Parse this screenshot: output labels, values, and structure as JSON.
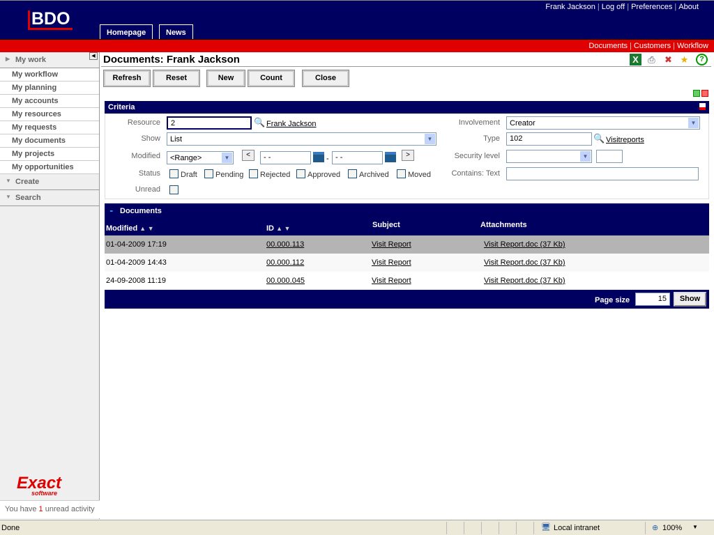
{
  "header": {
    "logo": "BDO",
    "tabs": [
      "Homepage",
      "News"
    ],
    "user_links": [
      "Frank Jackson",
      "Log off",
      "Preferences",
      "About"
    ]
  },
  "redbar": {
    "links": [
      "Documents",
      "Customers",
      "Workflow"
    ]
  },
  "sidebar": {
    "my_work": "My work",
    "items": [
      "My workflow",
      "My planning",
      "My accounts",
      "My resources",
      "My requests",
      "My documents",
      "My projects",
      "My opportunities"
    ],
    "create": "Create",
    "search": "Search",
    "brand": "Exact",
    "brand_sub": "software",
    "unread_prefix": "You have ",
    "unread_count": "1",
    "unread_suffix": " unread activity"
  },
  "page": {
    "title": "Documents: Frank Jackson",
    "toolbar": [
      "Refresh",
      "Reset",
      "New",
      "Count",
      "Close"
    ],
    "icons": [
      "excel-icon",
      "print-icon",
      "tools-icon",
      "favorite-icon",
      "help-icon"
    ]
  },
  "criteria": {
    "title": "Criteria",
    "resource_label": "Resource",
    "resource_value": "2",
    "resource_name": "Frank Jackson",
    "show_label": "Show",
    "show_value": "List",
    "modified_label": "Modified",
    "modified_value": "<Range>",
    "date_from": "- -",
    "date_to": "- -",
    "date_sep": "-",
    "prev": "<",
    "next": ">",
    "status_label": "Status",
    "statuses": [
      "Draft",
      "Pending",
      "Rejected",
      "Approved",
      "Archived",
      "Moved"
    ],
    "unread_label": "Unread",
    "involvement_label": "Involvement",
    "involvement_value": "Creator",
    "type_label": "Type",
    "type_value": "102",
    "type_name": "Visitreports",
    "security_label": "Security level",
    "security_value": "",
    "contains_label": "Contains: Text",
    "contains_value": ""
  },
  "documents": {
    "title": "Documents",
    "columns": [
      "Modified",
      "ID",
      "Subject",
      "Attachments"
    ],
    "rows": [
      {
        "modified": "01-04-2009 17:19",
        "id": "00.000.113",
        "subject": "Visit Report",
        "attachment": "Visit Report.doc (37 Kb)"
      },
      {
        "modified": "01-04-2009 14:43",
        "id": "00.000.112",
        "subject": "Visit Report",
        "attachment": "Visit Report.doc (37 Kb)"
      },
      {
        "modified": "24-09-2008 11:19",
        "id": "00.000.045",
        "subject": "Visit Report",
        "attachment": "Visit Report.doc (37 Kb)"
      }
    ],
    "page_size_label": "Page size",
    "page_size": "15",
    "show_button": "Show"
  },
  "statusbar": {
    "status": "Done",
    "zone": "Local intranet",
    "zoom": "100%"
  },
  "colors": {
    "navy": "#000060",
    "red": "#e00000",
    "selected_row": "#b4b4b4"
  }
}
